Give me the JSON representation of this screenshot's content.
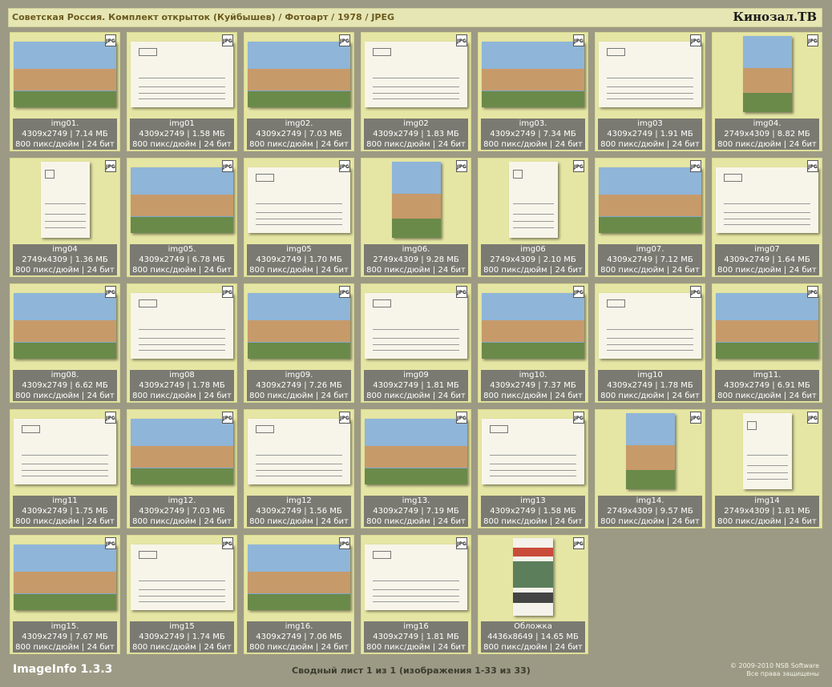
{
  "header": {
    "title": "Советская Россия. Комплект открыток (Куйбышев) / Фотоарт / 1978 / JPEG",
    "site": "Кинозал.ТВ"
  },
  "badge_label": "JPG",
  "items": [
    {
      "name": "img01.",
      "dims": "4309x2749 | 7.14 МБ",
      "res": "800 пикс/дюйм | 24 бит",
      "kind": "photo",
      "orient": "landscape"
    },
    {
      "name": "img01",
      "dims": "4309x2749 | 1.58 МБ",
      "res": "800 пикс/дюйм | 24 бит",
      "kind": "card",
      "orient": "landscape"
    },
    {
      "name": "img02.",
      "dims": "4309x2749 | 7.03 МБ",
      "res": "800 пикс/дюйм | 24 бит",
      "kind": "photo",
      "orient": "landscape"
    },
    {
      "name": "img02",
      "dims": "4309x2749 | 1.83 МБ",
      "res": "800 пикс/дюйм | 24 бит",
      "kind": "card",
      "orient": "landscape"
    },
    {
      "name": "img03.",
      "dims": "4309x2749 | 7.34 МБ",
      "res": "800 пикс/дюйм | 24 бит",
      "kind": "photo",
      "orient": "landscape"
    },
    {
      "name": "img03",
      "dims": "4309x2749 | 1.91 МБ",
      "res": "800 пикс/дюйм | 24 бит",
      "kind": "card",
      "orient": "landscape"
    },
    {
      "name": "img04.",
      "dims": "2749x4309 | 8.82 МБ",
      "res": "800 пикс/дюйм | 24 бит",
      "kind": "photo",
      "orient": "portrait"
    },
    {
      "name": "img04",
      "dims": "2749x4309 | 1.36 МБ",
      "res": "800 пикс/дюйм | 24 бит",
      "kind": "card",
      "orient": "portrait"
    },
    {
      "name": "img05.",
      "dims": "4309x2749 | 6.78 МБ",
      "res": "800 пикс/дюйм | 24 бит",
      "kind": "photo",
      "orient": "landscape"
    },
    {
      "name": "img05",
      "dims": "4309x2749 | 1.70 МБ",
      "res": "800 пикс/дюйм | 24 бит",
      "kind": "card",
      "orient": "landscape"
    },
    {
      "name": "img06.",
      "dims": "2749x4309 | 9.28 МБ",
      "res": "800 пикс/дюйм | 24 бит",
      "kind": "photo",
      "orient": "portrait"
    },
    {
      "name": "img06",
      "dims": "2749x4309 | 2.10 МБ",
      "res": "800 пикс/дюйм | 24 бит",
      "kind": "card",
      "orient": "portrait"
    },
    {
      "name": "img07.",
      "dims": "4309x2749 | 7.12 МБ",
      "res": "800 пикс/дюйм | 24 бит",
      "kind": "photo",
      "orient": "landscape"
    },
    {
      "name": "img07",
      "dims": "4309x2749 | 1.64 МБ",
      "res": "800 пикс/дюйм | 24 бит",
      "kind": "card",
      "orient": "landscape"
    },
    {
      "name": "img08.",
      "dims": "4309x2749 | 6.62 МБ",
      "res": "800 пикс/дюйм | 24 бит",
      "kind": "photo",
      "orient": "landscape"
    },
    {
      "name": "img08",
      "dims": "4309x2749 | 1.78 МБ",
      "res": "800 пикс/дюйм | 24 бит",
      "kind": "card",
      "orient": "landscape"
    },
    {
      "name": "img09.",
      "dims": "4309x2749 | 7.26 МБ",
      "res": "800 пикс/дюйм | 24 бит",
      "kind": "photo",
      "orient": "landscape"
    },
    {
      "name": "img09",
      "dims": "4309x2749 | 1.81 МБ",
      "res": "800 пикс/дюйм | 24 бит",
      "kind": "card",
      "orient": "landscape"
    },
    {
      "name": "img10.",
      "dims": "4309x2749 | 7.37 МБ",
      "res": "800 пикс/дюйм | 24 бит",
      "kind": "photo",
      "orient": "landscape"
    },
    {
      "name": "img10",
      "dims": "4309x2749 | 1.78 МБ",
      "res": "800 пикс/дюйм | 24 бит",
      "kind": "card",
      "orient": "landscape"
    },
    {
      "name": "img11.",
      "dims": "4309x2749 | 6.91 МБ",
      "res": "800 пикс/дюйм | 24 бит",
      "kind": "photo",
      "orient": "landscape"
    },
    {
      "name": "img11",
      "dims": "4309x2749 | 1.75 МБ",
      "res": "800 пикс/дюйм | 24 бит",
      "kind": "card",
      "orient": "landscape"
    },
    {
      "name": "img12.",
      "dims": "4309x2749 | 7.03 МБ",
      "res": "800 пикс/дюйм | 24 бит",
      "kind": "photo",
      "orient": "landscape"
    },
    {
      "name": "img12",
      "dims": "4309x2749 | 1.56 МБ",
      "res": "800 пикс/дюйм | 24 бит",
      "kind": "card",
      "orient": "landscape"
    },
    {
      "name": "img13.",
      "dims": "4309x2749 | 7.19 МБ",
      "res": "800 пикс/дюйм | 24 бит",
      "kind": "photo",
      "orient": "landscape"
    },
    {
      "name": "img13",
      "dims": "4309x2749 | 1.58 МБ",
      "res": "800 пикс/дюйм | 24 бит",
      "kind": "card",
      "orient": "landscape"
    },
    {
      "name": "img14.",
      "dims": "2749x4309 | 9.57 МБ",
      "res": "800 пикс/дюйм | 24 бит",
      "kind": "photo",
      "orient": "portrait"
    },
    {
      "name": "img14",
      "dims": "2749x4309 | 1.81 МБ",
      "res": "800 пикс/дюйм | 24 бит",
      "kind": "card",
      "orient": "portrait"
    },
    {
      "name": "img15.",
      "dims": "4309x2749 | 7.67 МБ",
      "res": "800 пикс/дюйм | 24 бит",
      "kind": "photo",
      "orient": "landscape"
    },
    {
      "name": "img15",
      "dims": "4309x2749 | 1.74 МБ",
      "res": "800 пикс/дюйм | 24 бит",
      "kind": "card",
      "orient": "landscape"
    },
    {
      "name": "img16.",
      "dims": "4309x2749 | 7.06 МБ",
      "res": "800 пикс/дюйм | 24 бит",
      "kind": "photo",
      "orient": "landscape"
    },
    {
      "name": "img16",
      "dims": "4309x2749 | 1.81 МБ",
      "res": "800 пикс/дюйм | 24 бит",
      "kind": "card",
      "orient": "landscape"
    },
    {
      "name": "Обложка",
      "dims": "4436x8649 | 14.65 МБ",
      "res": "800 пикс/дюйм | 24 бит",
      "kind": "cover",
      "orient": "tall"
    }
  ],
  "footer": {
    "app": "ImageInfo 1.3.3",
    "summary": "Сводный лист 1 из 1 (изображения 1-33 из 33)",
    "copyright": "© 2009-2010 NSB Software",
    "rights": "Все права защищены"
  }
}
